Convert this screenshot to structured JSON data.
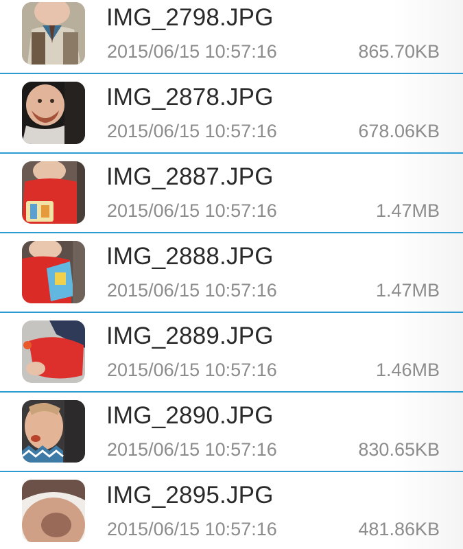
{
  "files": [
    {
      "name": "IMG_2798.JPG",
      "date": "2015/06/15 10:57:16",
      "size": "865.70KB",
      "thumbnail_icon": "photo-thumbnail-icon"
    },
    {
      "name": "IMG_2878.JPG",
      "date": "2015/06/15 10:57:16",
      "size": "678.06KB",
      "thumbnail_icon": "photo-thumbnail-icon"
    },
    {
      "name": "IMG_2887.JPG",
      "date": "2015/06/15 10:57:16",
      "size": "1.47MB",
      "thumbnail_icon": "photo-thumbnail-icon"
    },
    {
      "name": "IMG_2888.JPG",
      "date": "2015/06/15 10:57:16",
      "size": "1.47MB",
      "thumbnail_icon": "photo-thumbnail-icon"
    },
    {
      "name": "IMG_2889.JPG",
      "date": "2015/06/15 10:57:16",
      "size": "1.46MB",
      "thumbnail_icon": "photo-thumbnail-icon"
    },
    {
      "name": "IMG_2890.JPG",
      "date": "2015/06/15 10:57:16",
      "size": "830.65KB",
      "thumbnail_icon": "photo-thumbnail-icon"
    },
    {
      "name": "IMG_2895.JPG",
      "date": "2015/06/15 10:57:16",
      "size": "481.86KB",
      "thumbnail_icon": "photo-thumbnail-icon"
    }
  ],
  "colors": {
    "divider": "#2b9bd2",
    "name_text": "#2a2a2a",
    "meta_text": "#8c8c8c"
  }
}
